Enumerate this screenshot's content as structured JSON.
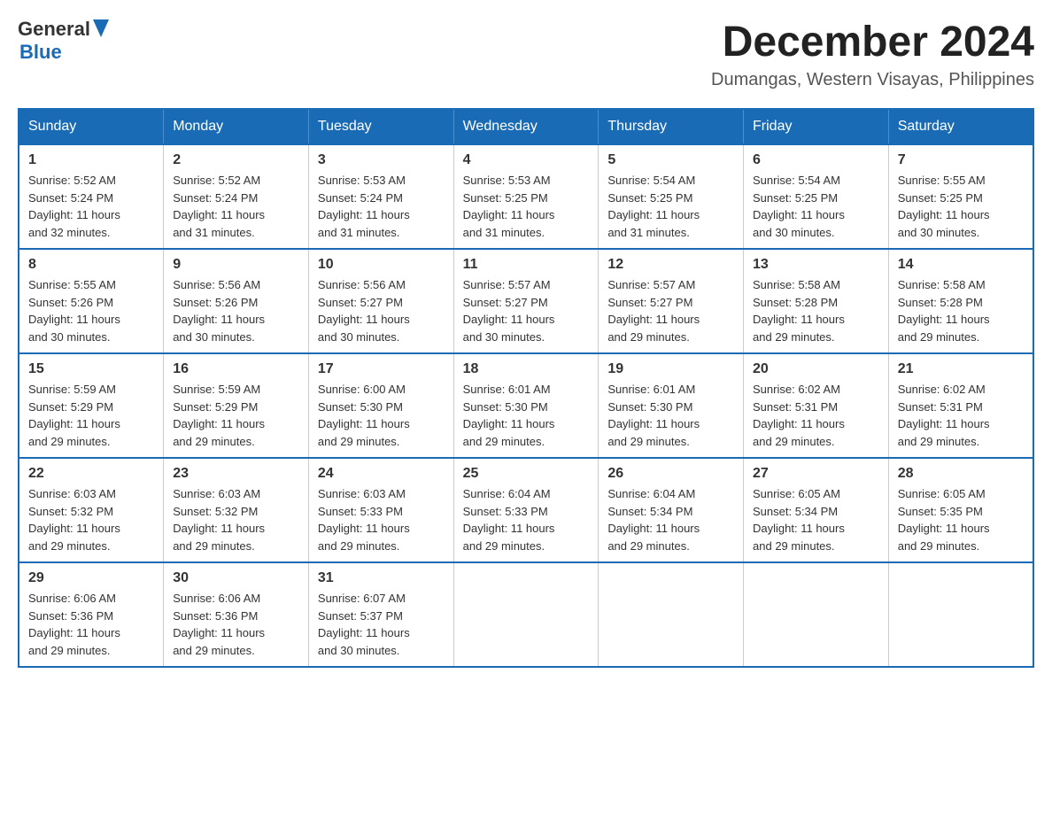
{
  "header": {
    "logo": {
      "general": "General",
      "blue": "Blue"
    },
    "title": "December 2024",
    "location": "Dumangas, Western Visayas, Philippines"
  },
  "days_of_week": [
    "Sunday",
    "Monday",
    "Tuesday",
    "Wednesday",
    "Thursday",
    "Friday",
    "Saturday"
  ],
  "weeks": [
    [
      {
        "day": "1",
        "sunrise": "5:52 AM",
        "sunset": "5:24 PM",
        "daylight": "11 hours and 32 minutes."
      },
      {
        "day": "2",
        "sunrise": "5:52 AM",
        "sunset": "5:24 PM",
        "daylight": "11 hours and 31 minutes."
      },
      {
        "day": "3",
        "sunrise": "5:53 AM",
        "sunset": "5:24 PM",
        "daylight": "11 hours and 31 minutes."
      },
      {
        "day": "4",
        "sunrise": "5:53 AM",
        "sunset": "5:25 PM",
        "daylight": "11 hours and 31 minutes."
      },
      {
        "day": "5",
        "sunrise": "5:54 AM",
        "sunset": "5:25 PM",
        "daylight": "11 hours and 31 minutes."
      },
      {
        "day": "6",
        "sunrise": "5:54 AM",
        "sunset": "5:25 PM",
        "daylight": "11 hours and 30 minutes."
      },
      {
        "day": "7",
        "sunrise": "5:55 AM",
        "sunset": "5:25 PM",
        "daylight": "11 hours and 30 minutes."
      }
    ],
    [
      {
        "day": "8",
        "sunrise": "5:55 AM",
        "sunset": "5:26 PM",
        "daylight": "11 hours and 30 minutes."
      },
      {
        "day": "9",
        "sunrise": "5:56 AM",
        "sunset": "5:26 PM",
        "daylight": "11 hours and 30 minutes."
      },
      {
        "day": "10",
        "sunrise": "5:56 AM",
        "sunset": "5:27 PM",
        "daylight": "11 hours and 30 minutes."
      },
      {
        "day": "11",
        "sunrise": "5:57 AM",
        "sunset": "5:27 PM",
        "daylight": "11 hours and 30 minutes."
      },
      {
        "day": "12",
        "sunrise": "5:57 AM",
        "sunset": "5:27 PM",
        "daylight": "11 hours and 29 minutes."
      },
      {
        "day": "13",
        "sunrise": "5:58 AM",
        "sunset": "5:28 PM",
        "daylight": "11 hours and 29 minutes."
      },
      {
        "day": "14",
        "sunrise": "5:58 AM",
        "sunset": "5:28 PM",
        "daylight": "11 hours and 29 minutes."
      }
    ],
    [
      {
        "day": "15",
        "sunrise": "5:59 AM",
        "sunset": "5:29 PM",
        "daylight": "11 hours and 29 minutes."
      },
      {
        "day": "16",
        "sunrise": "5:59 AM",
        "sunset": "5:29 PM",
        "daylight": "11 hours and 29 minutes."
      },
      {
        "day": "17",
        "sunrise": "6:00 AM",
        "sunset": "5:30 PM",
        "daylight": "11 hours and 29 minutes."
      },
      {
        "day": "18",
        "sunrise": "6:01 AM",
        "sunset": "5:30 PM",
        "daylight": "11 hours and 29 minutes."
      },
      {
        "day": "19",
        "sunrise": "6:01 AM",
        "sunset": "5:30 PM",
        "daylight": "11 hours and 29 minutes."
      },
      {
        "day": "20",
        "sunrise": "6:02 AM",
        "sunset": "5:31 PM",
        "daylight": "11 hours and 29 minutes."
      },
      {
        "day": "21",
        "sunrise": "6:02 AM",
        "sunset": "5:31 PM",
        "daylight": "11 hours and 29 minutes."
      }
    ],
    [
      {
        "day": "22",
        "sunrise": "6:03 AM",
        "sunset": "5:32 PM",
        "daylight": "11 hours and 29 minutes."
      },
      {
        "day": "23",
        "sunrise": "6:03 AM",
        "sunset": "5:32 PM",
        "daylight": "11 hours and 29 minutes."
      },
      {
        "day": "24",
        "sunrise": "6:03 AM",
        "sunset": "5:33 PM",
        "daylight": "11 hours and 29 minutes."
      },
      {
        "day": "25",
        "sunrise": "6:04 AM",
        "sunset": "5:33 PM",
        "daylight": "11 hours and 29 minutes."
      },
      {
        "day": "26",
        "sunrise": "6:04 AM",
        "sunset": "5:34 PM",
        "daylight": "11 hours and 29 minutes."
      },
      {
        "day": "27",
        "sunrise": "6:05 AM",
        "sunset": "5:34 PM",
        "daylight": "11 hours and 29 minutes."
      },
      {
        "day": "28",
        "sunrise": "6:05 AM",
        "sunset": "5:35 PM",
        "daylight": "11 hours and 29 minutes."
      }
    ],
    [
      {
        "day": "29",
        "sunrise": "6:06 AM",
        "sunset": "5:36 PM",
        "daylight": "11 hours and 29 minutes."
      },
      {
        "day": "30",
        "sunrise": "6:06 AM",
        "sunset": "5:36 PM",
        "daylight": "11 hours and 29 minutes."
      },
      {
        "day": "31",
        "sunrise": "6:07 AM",
        "sunset": "5:37 PM",
        "daylight": "11 hours and 30 minutes."
      },
      null,
      null,
      null,
      null
    ]
  ],
  "labels": {
    "sunrise": "Sunrise:",
    "sunset": "Sunset:",
    "daylight": "Daylight:"
  }
}
